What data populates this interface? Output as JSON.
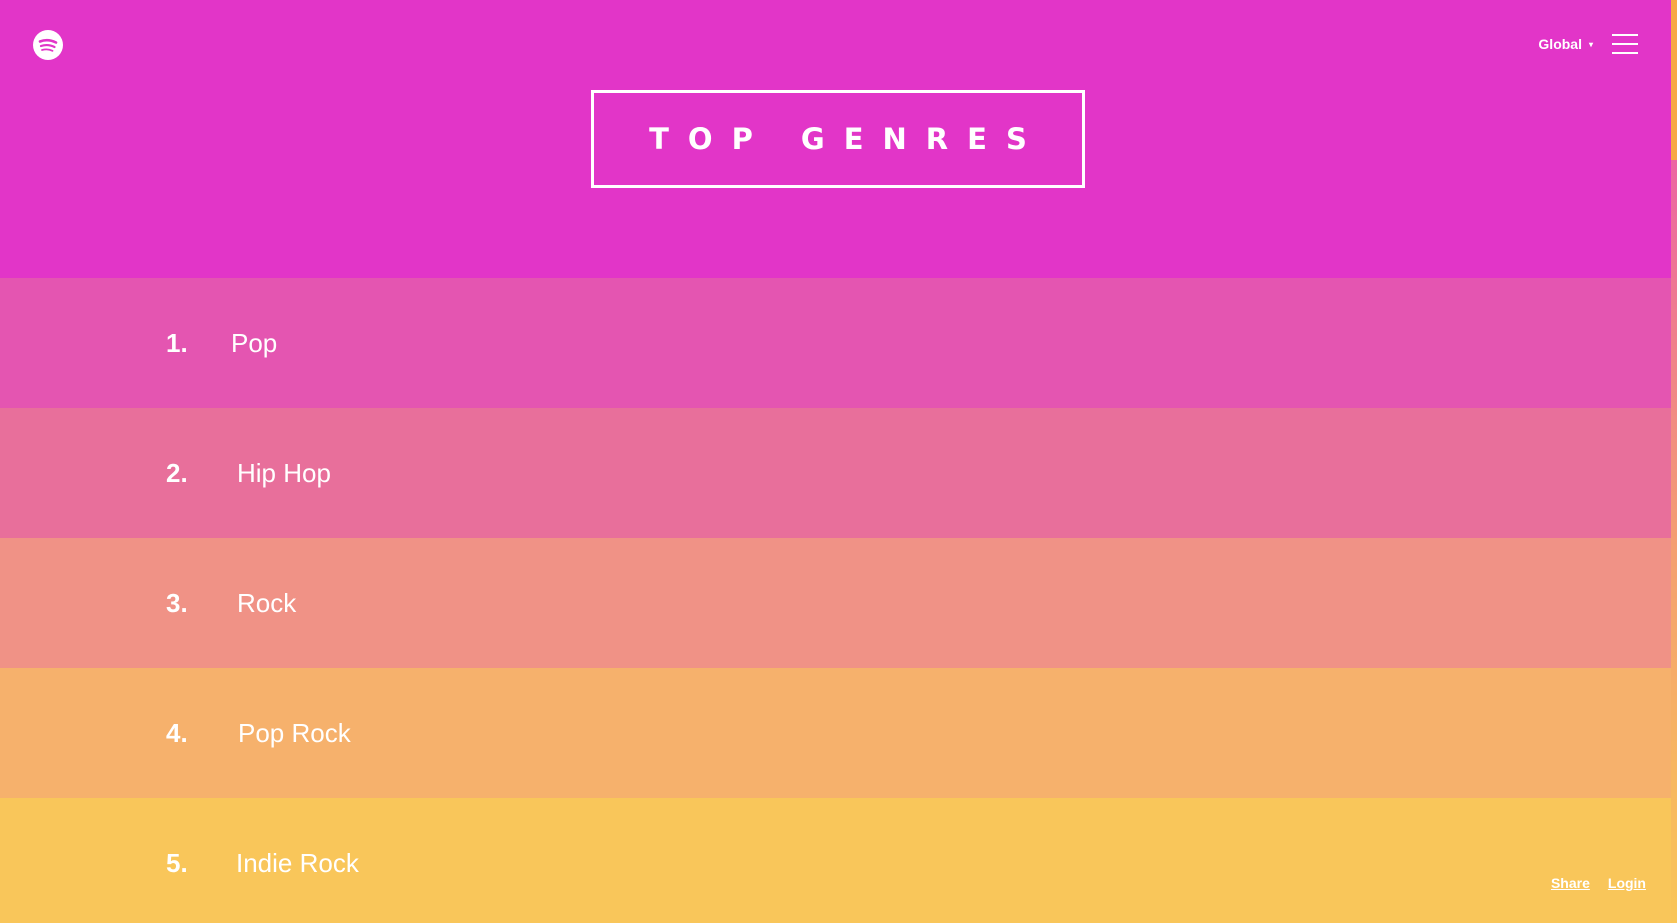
{
  "header": {
    "logo_icon": "spotify-logo-icon",
    "region_label": "Global",
    "region_caret": "▾",
    "menu_icon": "hamburger-menu-icon"
  },
  "title": "TOP GENRES",
  "genres": [
    {
      "rank": "1.",
      "name": "Pop",
      "color": "#e455b1"
    },
    {
      "rank": "2.",
      "name": "Hip Hop",
      "color": "#e86f9b"
    },
    {
      "rank": "3.",
      "name": "Rock",
      "color": "#f09286"
    },
    {
      "rank": "4.",
      "name": "Pop Rock",
      "color": "#f6b16c"
    },
    {
      "rank": "5.",
      "name": "Indie Rock",
      "color": "#f9c65a"
    }
  ],
  "footer": {
    "share_label": "Share",
    "login_label": "Login"
  },
  "colors": {
    "header_bg": "#e235c8",
    "text": "#ffffff"
  }
}
